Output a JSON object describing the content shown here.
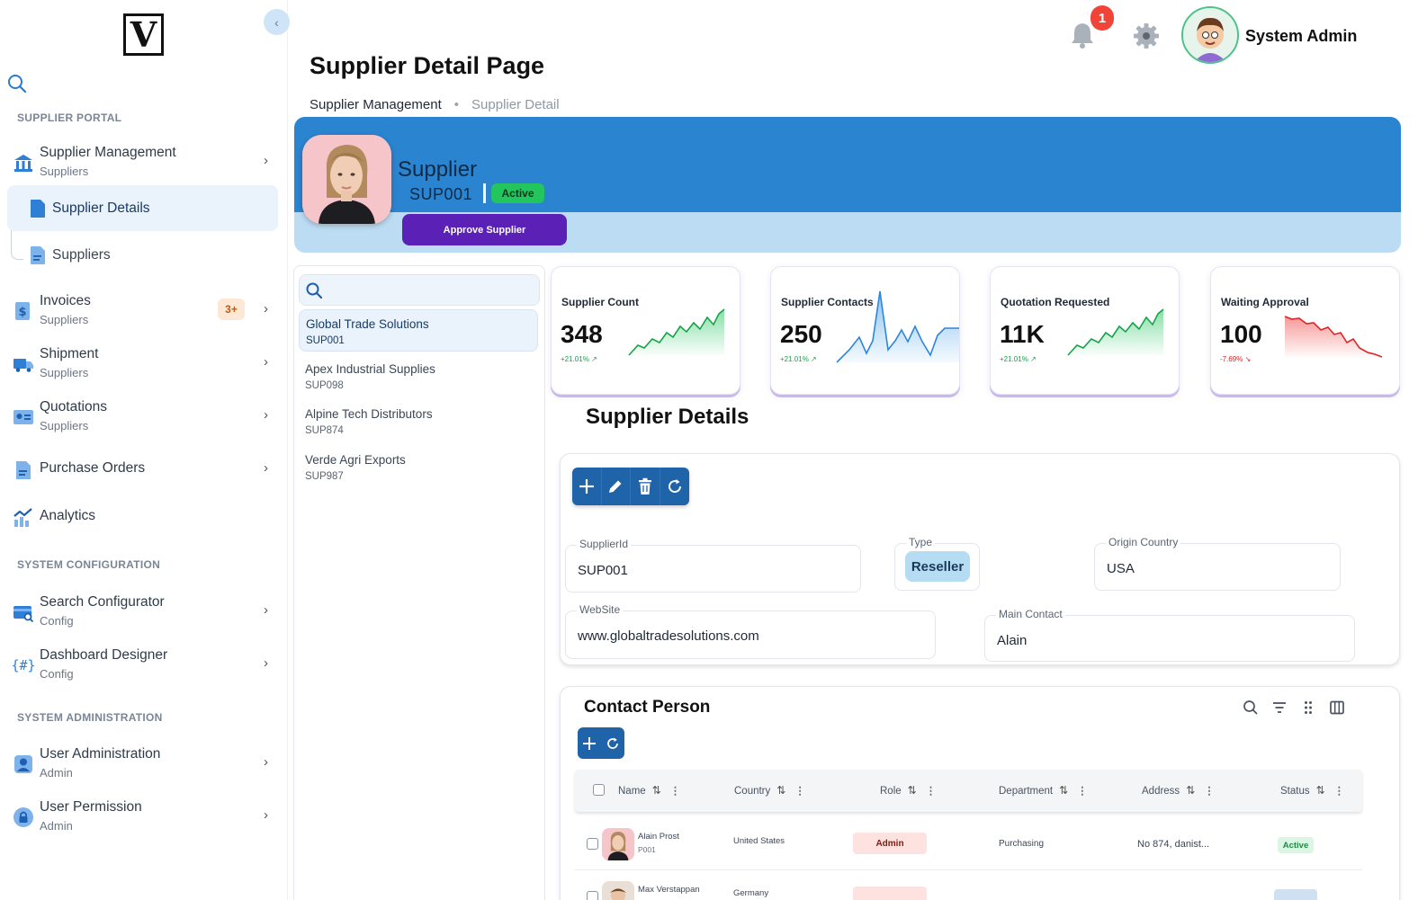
{
  "app": {
    "logo_letter": "V"
  },
  "sidebar": {
    "sections": {
      "portal": "SUPPLIER PORTAL",
      "config": "SYSTEM CONFIGURATION",
      "admin": "SYSTEM ADMINISTRATION"
    },
    "items": [
      {
        "title": "Supplier Management",
        "sub": "Suppliers",
        "icon": "bank-icon"
      },
      {
        "title": "Invoices",
        "sub": "Suppliers",
        "badge": "3+",
        "icon": "dollar-doc-icon"
      },
      {
        "title": "Shipment",
        "sub": "Suppliers",
        "icon": "truck-icon"
      },
      {
        "title": "Quotations",
        "sub": "Suppliers",
        "icon": "id-card-icon"
      },
      {
        "title": "Purchase Orders",
        "icon": "document-icon"
      },
      {
        "title": "Analytics",
        "icon": "chart-icon"
      },
      {
        "title": "Search Configurator",
        "sub": "Config",
        "icon": "search-card-icon"
      },
      {
        "title": "Dashboard Designer",
        "sub": "Config",
        "icon": "hash-icon"
      },
      {
        "title": "User Administration",
        "sub": "Admin",
        "icon": "user-icon"
      },
      {
        "title": "User Permission",
        "sub": "Admin",
        "icon": "lock-icon"
      }
    ],
    "subitems": [
      {
        "title": "Supplier Details",
        "active": true
      },
      {
        "title": "Suppliers"
      }
    ]
  },
  "header": {
    "notification_count": "1",
    "user_name": "System Admin"
  },
  "page": {
    "title": "Supplier Detail Page",
    "breadcrumb": [
      "Supplier Management",
      "Supplier Detail"
    ]
  },
  "supplier": {
    "name": "Supplier",
    "id": "SUP001",
    "status": "Active",
    "approve_label": "Approve Supplier"
  },
  "supplier_list": [
    {
      "name": "Global Trade Solutions",
      "id": "SUP001",
      "active": true
    },
    {
      "name": "Apex Industrial Supplies",
      "id": "SUP098"
    },
    {
      "name": "Alpine Tech Distributors",
      "id": "SUP874"
    },
    {
      "name": "Verde Agri Exports",
      "id": "SUP987"
    }
  ],
  "kpis": [
    {
      "label": "Supplier Count",
      "value": "348",
      "change": "+21.01%",
      "trend": "up",
      "color": "#22c55e"
    },
    {
      "label": "Supplier Contacts",
      "value": "250",
      "change": "+21.01%",
      "trend": "up",
      "color": "#3b9be8"
    },
    {
      "label": "Quotation Requested",
      "value": "11K",
      "change": "+21.01%",
      "trend": "up",
      "color": "#22c55e"
    },
    {
      "label": "Waiting Approval",
      "value": "100",
      "change": "-7.69%",
      "trend": "down",
      "color": "#ef4444"
    }
  ],
  "details": {
    "title": "Supplier Details",
    "fields": {
      "supplier_id": {
        "label": "SupplierId",
        "value": "SUP001"
      },
      "type": {
        "label": "Type",
        "value": "Reseller"
      },
      "origin_country": {
        "label": "Origin Country",
        "value": "USA"
      },
      "website": {
        "label": "WebSite",
        "value": "www.globaltradesolutions.com"
      },
      "main_contact": {
        "label": "Main Contact",
        "value": "Alain"
      }
    }
  },
  "contacts": {
    "title": "Contact Person",
    "columns": [
      "Name",
      "Country",
      "Role",
      "Department",
      "Address",
      "Status"
    ],
    "rows": [
      {
        "name": "Alain Prost",
        "code": "P001",
        "country": "United States",
        "role": "Admin",
        "department": "Purchasing",
        "address": "No 874, danist...",
        "status": "Active"
      },
      {
        "name": "Max Verstappan",
        "country": "Germany"
      }
    ]
  }
}
